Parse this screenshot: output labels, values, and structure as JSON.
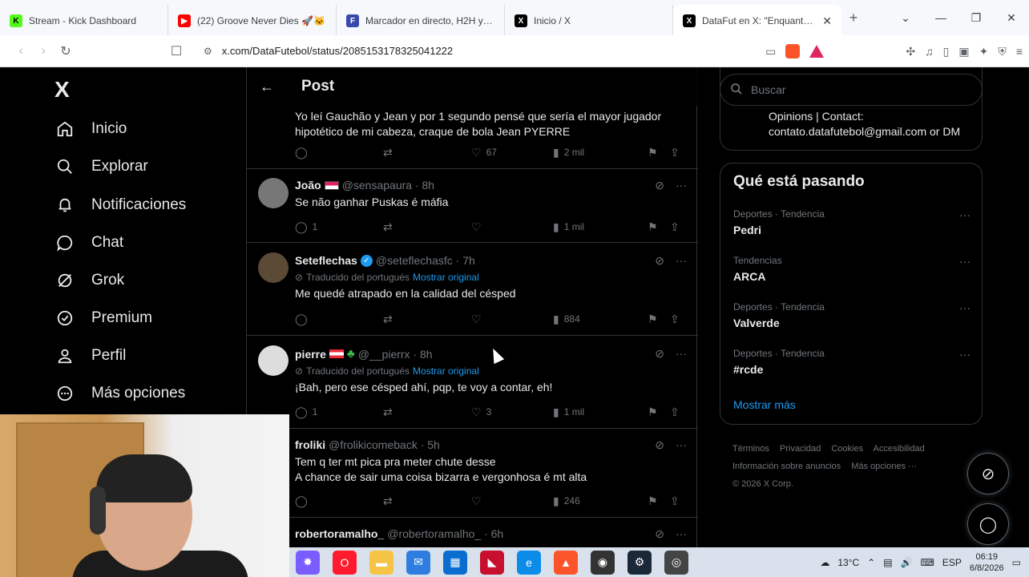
{
  "tabs": [
    {
      "title": "Stream - Kick Dashboard",
      "favicon": "kick-icon",
      "color": "#53fc18"
    },
    {
      "title": "(22) Groove Never Dies 🚀🐱",
      "favicon": "youtube-icon",
      "color": "#ff0000"
    },
    {
      "title": "Marcador en directo, H2H y aline",
      "favicon": "flashscore-icon",
      "color": "#3949ab"
    },
    {
      "title": "Inicio / X",
      "favicon": "x-icon",
      "color": "#000000"
    },
    {
      "title": "DataFut en X: \"Enquanto iss",
      "favicon": "x-icon",
      "color": "#000000"
    }
  ],
  "address": {
    "url": "x.com/DataFutebol/status/2085153178325041222"
  },
  "nav": {
    "logo": "X",
    "items": [
      {
        "label": "Inicio",
        "icon": "home-icon"
      },
      {
        "label": "Explorar",
        "icon": "search-icon"
      },
      {
        "label": "Notificaciones",
        "icon": "bell-icon"
      },
      {
        "label": "Chat",
        "icon": "chat-icon"
      },
      {
        "label": "Grok",
        "icon": "grok-icon"
      },
      {
        "label": "Premium",
        "icon": "premium-icon"
      },
      {
        "label": "Perfil",
        "icon": "person-icon"
      },
      {
        "label": "Más opciones",
        "icon": "more-icon"
      }
    ]
  },
  "header": {
    "title": "Post"
  },
  "tweets": [
    {
      "text": "Yo leí Gauchão y Jean y por 1 segundo pensé que sería el mayor jugador hipotético de mi cabeza, craque de bola Jean PYERRE",
      "replies": "",
      "likes": "67",
      "views": "2 mil"
    },
    {
      "name": "João",
      "handle": "@sensapaura · 8h",
      "text": "Se não ganhar Puskas é máfia",
      "replies": "1",
      "likes": "",
      "views": "1 mil"
    },
    {
      "name": "Seteflechas",
      "handle": "@seteflechasfc · 7h",
      "translated": "Traducido del portugués",
      "original": "Mostrar original",
      "text": "Me quedé atrapado en la calidad del césped",
      "replies": "",
      "likes": "",
      "views": "884"
    },
    {
      "name": "pierre",
      "handle": "@__pierrx · 8h",
      "translated": "Traducido del portugués",
      "original": "Mostrar original",
      "text": "¡Bah, pero ese césped ahí, pqp, te voy a contar, eh!",
      "replies": "1",
      "likes": "3",
      "views": "1 mil"
    },
    {
      "name": "froliki",
      "handle": "@frolikicomeback · 5h",
      "text": "Tem q ter mt pica pra meter chute desse",
      "text2": "A chance de sair uma coisa bizarra e vergonhosa é mt alta",
      "replies": "",
      "likes": "",
      "views": "246"
    },
    {
      "name": "robertoramalho_",
      "handle": "@robertoramalho_ · 6h"
    }
  ],
  "search": {
    "placeholder": "Buscar"
  },
  "profile": {
    "bio_line1": "Opinions | Contact:",
    "bio_line2": "contato.datafutebol@gmail.com or DM"
  },
  "trends": {
    "title": "Qué está pasando",
    "items": [
      {
        "context": "Deportes · Tendencia",
        "name": "Pedri"
      },
      {
        "context": "Tendencias",
        "name": "ARCA"
      },
      {
        "context": "Deportes · Tendencia",
        "name": "Valverde"
      },
      {
        "context": "Deportes · Tendencia",
        "name": "#rcde"
      }
    ],
    "show_more": "Mostrar más"
  },
  "footer": {
    "links": [
      "Términos",
      "Privacidad",
      "Cookies",
      "Accesibilidad",
      "Información sobre anuncios",
      "Más opciones ···"
    ],
    "copyright": "© 2026 X Corp."
  },
  "taskbar": {
    "temp": "13°C",
    "lang": "ESP",
    "time": "06:19",
    "date": "6/8/2026"
  }
}
